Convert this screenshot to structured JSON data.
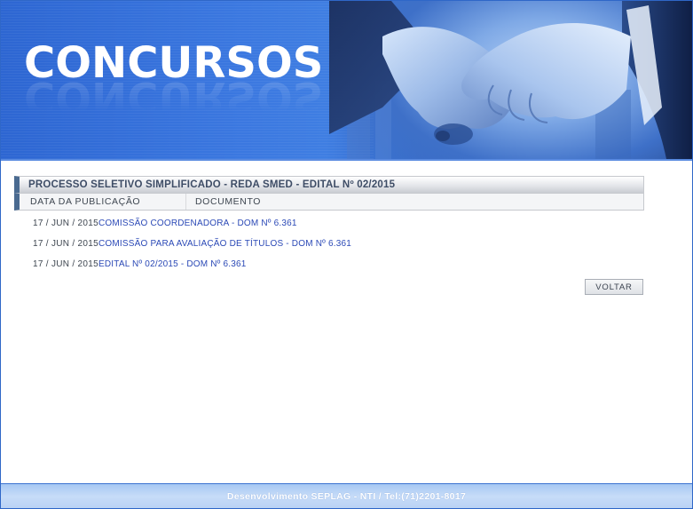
{
  "banner": {
    "title": "CONCURSOS",
    "image_icon": "handshake-photo"
  },
  "panel": {
    "title": "PROCESSO SELETIVO SIMPLIFICADO - REDA SMED - EDITAL Nº 02/2015",
    "columns": {
      "date": "DATA DA PUBLICAÇÃO",
      "document": "DOCUMENTO"
    }
  },
  "documents": [
    {
      "date": "17 / JUN / 2015",
      "title": "COMISSÃO COORDENADORA - DOM Nº 6.361"
    },
    {
      "date": "17 / JUN / 2015",
      "title": "COMISSÃO PARA AVALIAÇÃO DE TÍTULOS - DOM Nº 6.361"
    },
    {
      "date": "17 / JUN / 2015",
      "title": "EDITAL Nº 02/2015 - DOM Nº 6.361"
    }
  ],
  "actions": {
    "back_label": "VOLTAR"
  },
  "footer": {
    "text": "Desenvolvimento SEPLAG - NTI / Tel:(71)2201-8017"
  },
  "colors": {
    "banner_blue": "#3b78e0",
    "link_blue": "#2b49b6",
    "header_accent": "#4a6a90",
    "footer_blue": "#b8d1f4"
  }
}
